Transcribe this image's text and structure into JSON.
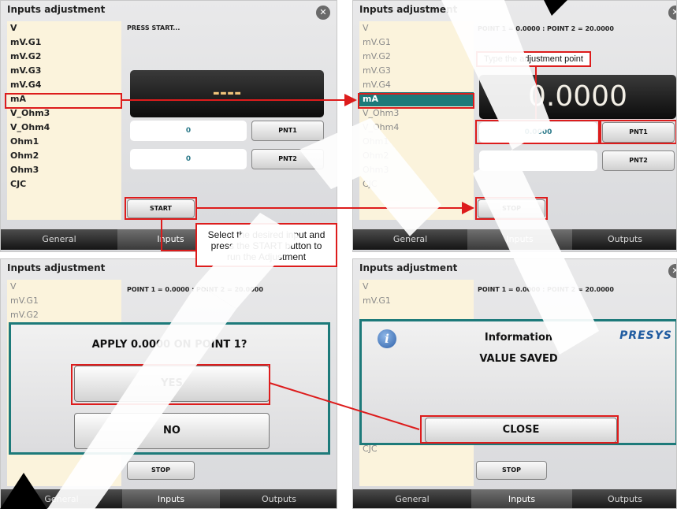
{
  "panel1": {
    "title": "Inputs adjustment",
    "inputs": [
      "V",
      "mV.G1",
      "mV.G2",
      "mV.G3",
      "mV.G4",
      "mA",
      "V_Ohm3",
      "V_Ohm4",
      "Ohm1",
      "Ohm2",
      "Ohm3",
      "CJC"
    ],
    "status": "PRESS START...",
    "display_value": "----",
    "field1_value": "0",
    "field2_value": "0",
    "pnt1_label": "PNT1",
    "pnt2_label": "PNT2",
    "start_label": "START",
    "tabs": [
      "General",
      "Inputs"
    ]
  },
  "panel2": {
    "title": "Inputs adjustment",
    "inputs": [
      "V",
      "mV.G1",
      "mV.G2",
      "mV.G3",
      "mV.G4",
      "mA",
      "V_Ohm3",
      "V_Ohm4",
      "Ohm1",
      "Ohm2",
      "Ohm3",
      "CJC"
    ],
    "status": "POINT 1 = 0.0000 : POINT 2 = 20.0000",
    "display_value": "0.0000",
    "field1_value": "0.0000",
    "pnt1_label": "PNT1",
    "pnt2_label": "PNT2",
    "stop_label": "STOP",
    "tabs": [
      "General",
      "Inputs",
      "Outputs"
    ]
  },
  "panel3": {
    "title": "Inputs adjustment",
    "inputs": [
      "V",
      "mV.G1",
      "mV.G2"
    ],
    "status": "POINT 1 = 0.0000 : POINT 2 = 20.0000",
    "question": "APPLY 0.0000 ON POINT 1?",
    "yes_label": "YES",
    "no_label": "NO",
    "stop_label": "STOP",
    "tabs": [
      "General",
      "Inputs",
      "Outputs"
    ]
  },
  "panel4": {
    "title": "Inputs adjustment",
    "inputs": [
      "V",
      "mV.G1"
    ],
    "last_input": "CJC",
    "status": "POINT 1 = 0.0000 : POINT 2 = 20.0000",
    "info_title": "Information",
    "info_message": "VALUE SAVED",
    "brand": "PRESYS",
    "close_label": "CLOSE",
    "stop_label": "STOP",
    "tabs": [
      "General",
      "Inputs",
      "Outputs"
    ]
  },
  "annotations": {
    "adjust_point_label": "Type the adjustment point",
    "start_instruction_line1": "Select the desired input and",
    "start_instruction_line2": "press the START button to",
    "start_instruction_line3": "run the Adjustment"
  },
  "colors": {
    "teal": "#1d7a7a",
    "highlight_red": "#dd1c1c",
    "list_bg": "#fbf3dc"
  },
  "icons": {
    "close": "close-icon",
    "info": "info-icon"
  }
}
